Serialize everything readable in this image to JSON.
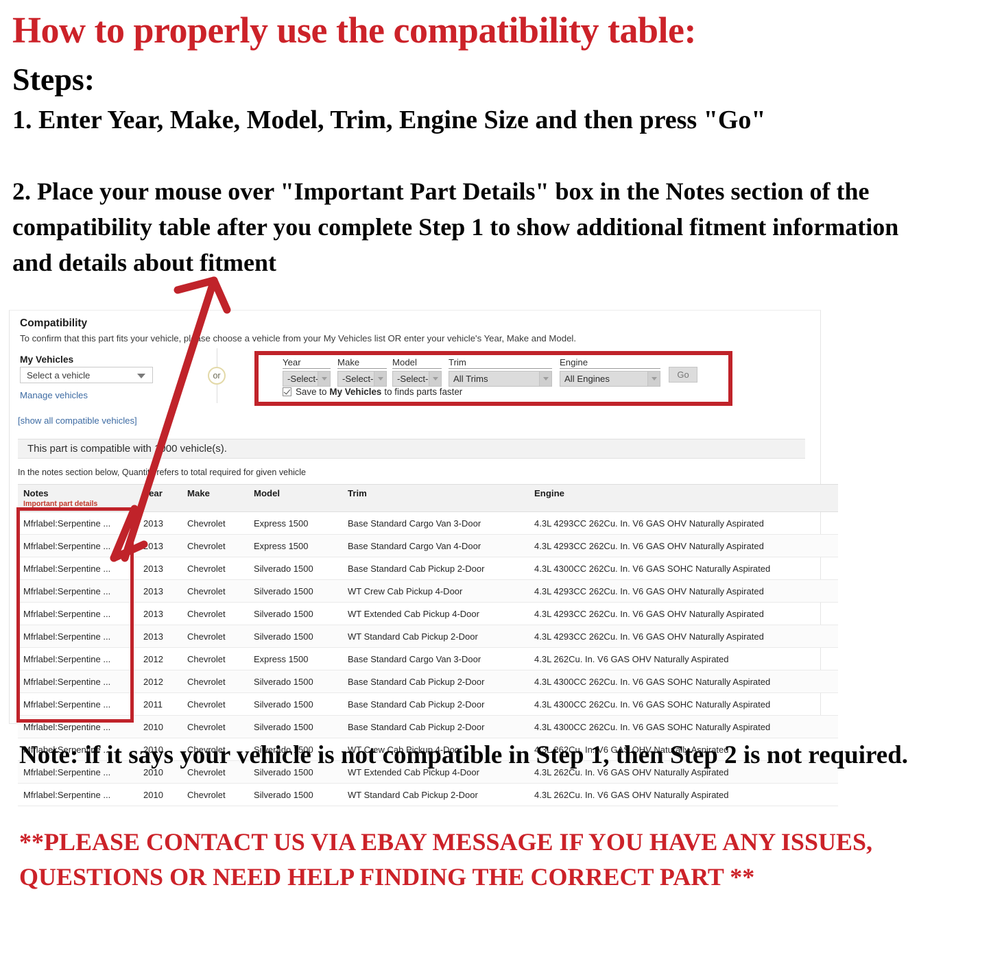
{
  "instructions": {
    "headline": "How to properly use the compatibility table:",
    "steps_label": "Steps:",
    "step_one": "1. Enter Year, Make, Model, Trim, Engine Size and then press \"Go\"",
    "step_two": "2. Place your mouse over \"Important Part Details\" box in the Notes section of the compatibility table after you complete Step 1 to show additional fitment information and details about fitment",
    "note": "Note: if it says your vehicle is not compatible in Step 1, then Step 2 is not required.",
    "contact": "**PLEASE CONTACT US VIA EBAY MESSAGE IF YOU HAVE ANY ISSUES, QUESTIONS OR NEED HELP FINDING THE CORRECT PART **"
  },
  "colors": {
    "headline_red": "#cc2229",
    "highlight_red": "#c0232a",
    "link_blue": "#3d6ba3",
    "notes_sub_red": "#c0392b"
  },
  "compatibility": {
    "title": "Compatibility",
    "subtitle": "To confirm that this part fits your vehicle, please choose a vehicle from your My Vehicles list OR enter your vehicle's Year, Make and Model.",
    "my_vehicles_label": "My Vehicles",
    "my_vehicles_value": "Select a vehicle",
    "manage_vehicles_link": "Manage vehicles",
    "show_all_link": "[show all compatible vehicles]",
    "or_divider": "or",
    "compatible_banner": "This part is compatible with 1000 vehicle(s).",
    "notes_hint": "In the notes section below, Quantity refers to total required for given vehicle",
    "selectors": [
      {
        "label": "Year",
        "value": "-Select-",
        "name": "year"
      },
      {
        "label": "Make",
        "value": "-Select-",
        "name": "make"
      },
      {
        "label": "Model",
        "value": "-Select-",
        "name": "model"
      },
      {
        "label": "Trim",
        "value": "All Trims",
        "name": "trim"
      },
      {
        "label": "Engine",
        "value": "All Engines",
        "name": "engine"
      }
    ],
    "go_label": "Go",
    "save_prefix": "Save to",
    "save_bold": "My Vehicles",
    "save_suffix": "to finds parts faster",
    "save_checked": true
  },
  "table": {
    "headers": {
      "notes": "Notes",
      "notes_sub": "Important part details",
      "year": "Year",
      "make": "Make",
      "model": "Model",
      "trim": "Trim",
      "engine": "Engine"
    },
    "rows": [
      {
        "notes": "Mfrlabel:Serpentine ...",
        "year": "2013",
        "make": "Chevrolet",
        "model": "Express 1500",
        "trim": "Base Standard Cargo Van 3-Door",
        "engine": "4.3L 4293CC 262Cu. In. V6 GAS OHV Naturally Aspirated"
      },
      {
        "notes": "Mfrlabel:Serpentine ...",
        "year": "2013",
        "make": "Chevrolet",
        "model": "Express 1500",
        "trim": "Base Standard Cargo Van 4-Door",
        "engine": "4.3L 4293CC 262Cu. In. V6 GAS OHV Naturally Aspirated"
      },
      {
        "notes": "Mfrlabel:Serpentine ...",
        "year": "2013",
        "make": "Chevrolet",
        "model": "Silverado 1500",
        "trim": "Base Standard Cab Pickup 2-Door",
        "engine": "4.3L 4300CC 262Cu. In. V6 GAS SOHC Naturally Aspirated"
      },
      {
        "notes": "Mfrlabel:Serpentine ...",
        "year": "2013",
        "make": "Chevrolet",
        "model": "Silverado 1500",
        "trim": "WT Crew Cab Pickup 4-Door",
        "engine": "4.3L 4293CC 262Cu. In. V6 GAS OHV Naturally Aspirated"
      },
      {
        "notes": "Mfrlabel:Serpentine ...",
        "year": "2013",
        "make": "Chevrolet",
        "model": "Silverado 1500",
        "trim": "WT Extended Cab Pickup 4-Door",
        "engine": "4.3L 4293CC 262Cu. In. V6 GAS OHV Naturally Aspirated"
      },
      {
        "notes": "Mfrlabel:Serpentine ...",
        "year": "2013",
        "make": "Chevrolet",
        "model": "Silverado 1500",
        "trim": "WT Standard Cab Pickup 2-Door",
        "engine": "4.3L 4293CC 262Cu. In. V6 GAS OHV Naturally Aspirated"
      },
      {
        "notes": "Mfrlabel:Serpentine ...",
        "year": "2012",
        "make": "Chevrolet",
        "model": "Express 1500",
        "trim": "Base Standard Cargo Van 3-Door",
        "engine": "4.3L 262Cu. In. V6 GAS OHV Naturally Aspirated"
      },
      {
        "notes": "Mfrlabel:Serpentine ...",
        "year": "2012",
        "make": "Chevrolet",
        "model": "Silverado 1500",
        "trim": "Base Standard Cab Pickup 2-Door",
        "engine": "4.3L 4300CC 262Cu. In. V6 GAS SOHC Naturally Aspirated"
      },
      {
        "notes": "Mfrlabel:Serpentine ...",
        "year": "2011",
        "make": "Chevrolet",
        "model": "Silverado 1500",
        "trim": "Base Standard Cab Pickup 2-Door",
        "engine": "4.3L 4300CC 262Cu. In. V6 GAS SOHC Naturally Aspirated"
      },
      {
        "notes": "Mfrlabel:Serpentine ...",
        "year": "2010",
        "make": "Chevrolet",
        "model": "Silverado 1500",
        "trim": "Base Standard Cab Pickup 2-Door",
        "engine": "4.3L 4300CC 262Cu. In. V6 GAS SOHC Naturally Aspirated"
      },
      {
        "notes": "Mfrlabel:Serpentine ...",
        "year": "2010",
        "make": "Chevrolet",
        "model": "Silverado 1500",
        "trim": "WT Crew Cab Pickup 4-Door",
        "engine": "4.3L 262Cu. In. V6 GAS OHV Naturally Aspirated"
      },
      {
        "notes": "Mfrlabel:Serpentine ...",
        "year": "2010",
        "make": "Chevrolet",
        "model": "Silverado 1500",
        "trim": "WT Extended Cab Pickup 4-Door",
        "engine": "4.3L 262Cu. In. V6 GAS OHV Naturally Aspirated"
      },
      {
        "notes": "Mfrlabel:Serpentine ...",
        "year": "2010",
        "make": "Chevrolet",
        "model": "Silverado 1500",
        "trim": "WT Standard Cab Pickup 2-Door",
        "engine": "4.3L 262Cu. In. V6 GAS OHV Naturally Aspirated"
      }
    ]
  },
  "annotations": {
    "arrow_label": "arrow pointing from notes column up to step 2 text",
    "selector_highlight_label": "red highlight box around year make model trim engine selectors",
    "notes_highlight_label": "red highlight box around notes column"
  }
}
